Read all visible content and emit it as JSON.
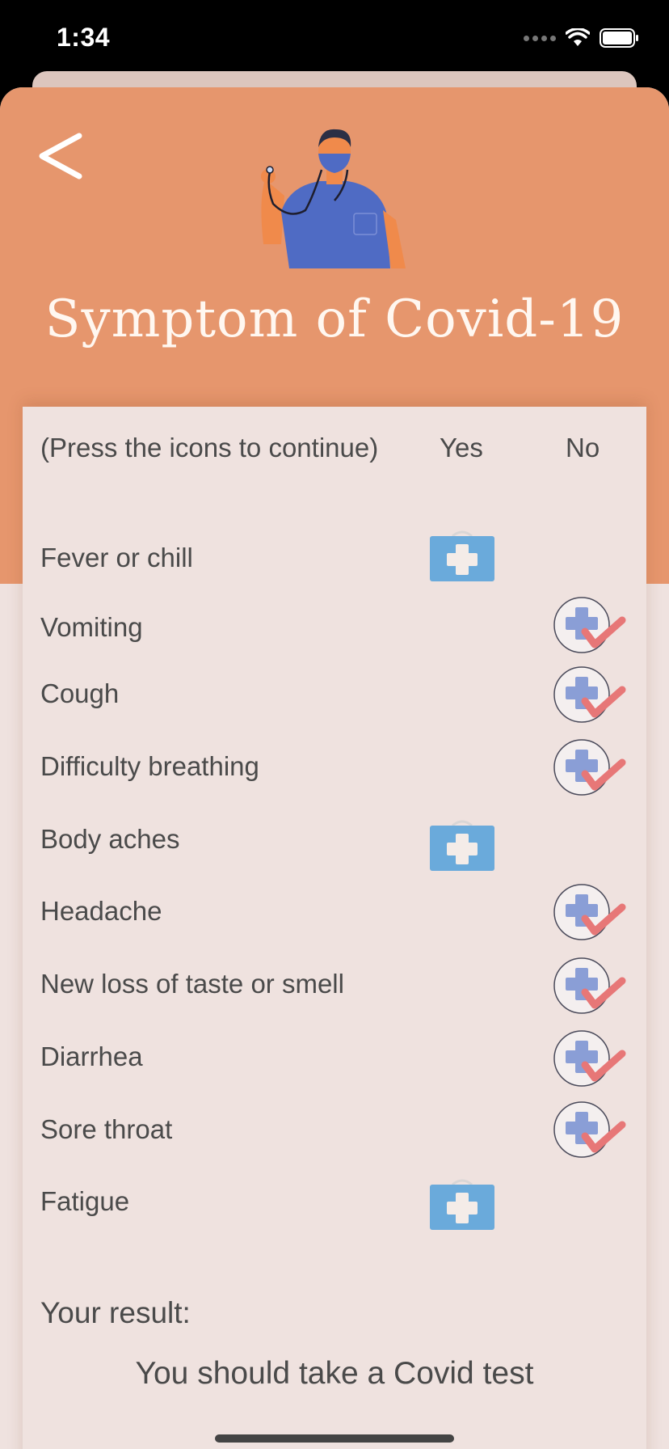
{
  "status_bar": {
    "time": "1:34",
    "icons": [
      "cellular-signal-icon",
      "wifi-icon",
      "battery-icon"
    ]
  },
  "header": {
    "back_icon": "chevron-left-icon",
    "illustration": "doctor-with-stethoscope",
    "title": "Symptom of Covid-19"
  },
  "table": {
    "instruction": "(Press the icons to continue)",
    "yes_label": "Yes",
    "no_label": "No",
    "rows": [
      {
        "label": "Fever or chill",
        "answer": "yes"
      },
      {
        "label": "Vomiting",
        "answer": "no"
      },
      {
        "label": "Cough",
        "answer": "no"
      },
      {
        "label": "Difficulty breathing",
        "answer": "no"
      },
      {
        "label": "Body aches",
        "answer": "yes"
      },
      {
        "label": "Headache",
        "answer": "no"
      },
      {
        "label": "New loss of taste or smell",
        "answer": "no"
      },
      {
        "label": "Diarrhea",
        "answer": "no"
      },
      {
        "label": "Sore throat",
        "answer": "no"
      },
      {
        "label": "Fatigue",
        "answer": "yes"
      }
    ]
  },
  "result": {
    "label": "Your result:",
    "text": "You should take a Covid test"
  },
  "colors": {
    "header": "#e6966d",
    "background": "#efe2df",
    "yes_icon": "#6aaadb",
    "no_icon_cross": "#8a9ed6",
    "no_icon_check": "#e77777"
  }
}
